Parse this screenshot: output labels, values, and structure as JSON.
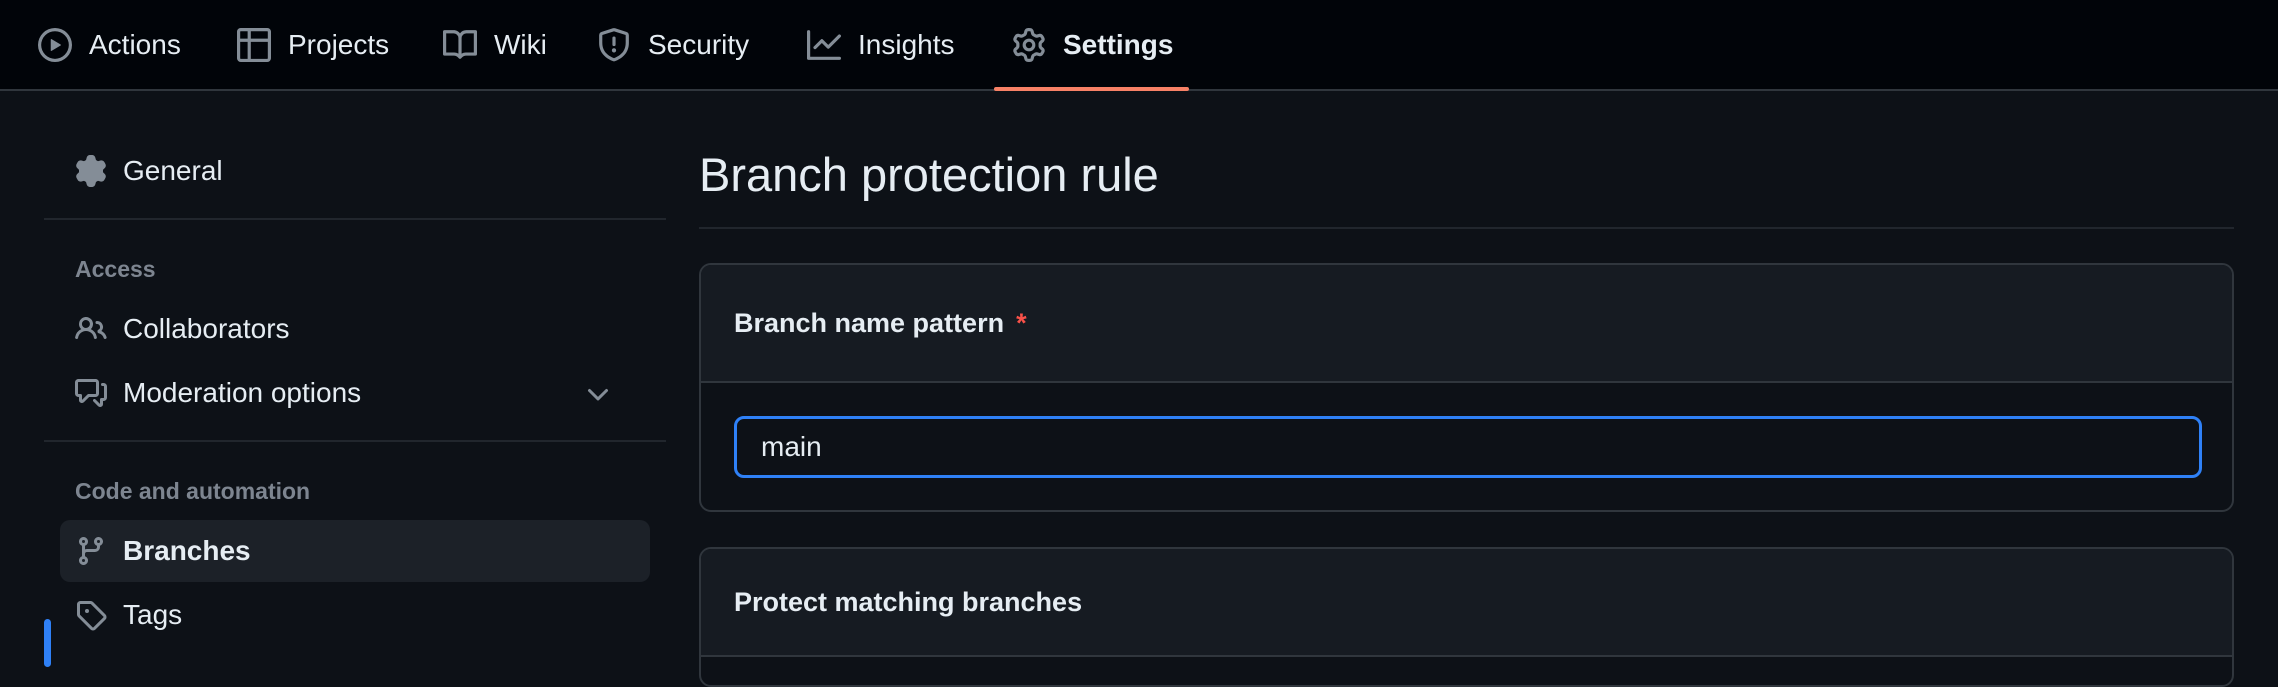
{
  "topnav": {
    "tabs": [
      {
        "label": "Actions",
        "icon": "play-icon"
      },
      {
        "label": "Projects",
        "icon": "table-icon"
      },
      {
        "label": "Wiki",
        "icon": "book-icon"
      },
      {
        "label": "Security",
        "icon": "shield-icon"
      },
      {
        "label": "Insights",
        "icon": "graph-icon"
      },
      {
        "label": "Settings",
        "icon": "gear-icon",
        "active": true
      }
    ]
  },
  "sidebar": {
    "general": "General",
    "access_heading": "Access",
    "collaborators": "Collaborators",
    "moderation": "Moderation options",
    "code_heading": "Code and automation",
    "branches": "Branches",
    "tags": "Tags"
  },
  "main": {
    "title": "Branch protection rule",
    "pattern_label": "Branch name pattern",
    "required_mark": "*",
    "pattern_value": "main",
    "protect_heading": "Protect matching branches"
  },
  "colors": {
    "accent": "#2f81f7",
    "active_tab_underline": "#f78166",
    "required": "#f85149"
  }
}
